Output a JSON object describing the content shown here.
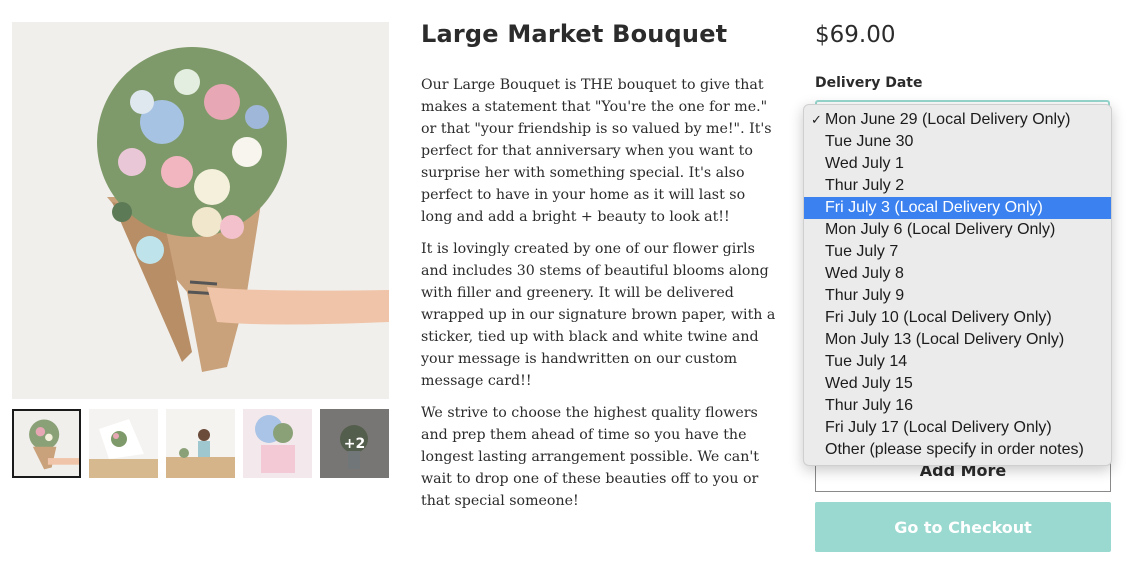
{
  "product": {
    "title": "Large Market Bouquet",
    "description": [
      "Our Large Bouquet is THE bouquet to give that makes a statement that \"You're the one for me.\" or that \"your friendship is so valued by me!\". It's perfect for that anniversary when you want to surprise her with something special. It's also perfect to have in your home as it will last so long and add a bright + beauty to look at!!",
      "It is lovingly created by one of our flower girls and includes 30 stems of beautiful blooms along with filler and greenery. It will be delivered wrapped up in our signature brown paper, with a sticker, tied up with black and white twine and your message is handwritten on our custom message card!!",
      "We strive to choose the highest quality flowers and prep them ahead of time so you have the longest lasting arrangement possible. We can't wait to drop one of these beauties off to you or that special someone!"
    ],
    "price": "$69.00"
  },
  "gallery": {
    "main_image": "bouquet-photo",
    "thumbnails": [
      {
        "image": "bouquet-in-hand",
        "active": true
      },
      {
        "image": "wrapping-bouquet"
      },
      {
        "image": "florist-at-table"
      },
      {
        "image": "pink-bouquet"
      },
      {
        "image": "vase-bouquet",
        "overlay": "+2"
      }
    ]
  },
  "delivery": {
    "label": "Delivery Date",
    "options": [
      "Mon June 29 (Local Delivery Only)",
      "Tue June 30",
      "Wed July 1",
      "Thur July 2",
      "Fri July 3 (Local Delivery Only)",
      "Mon July 6 (Local Delivery Only)",
      "Tue July 7",
      "Wed July 8",
      "Thur July 9",
      "Fri July 10 (Local Delivery Only)",
      "Mon July 13 (Local Delivery Only)",
      "Tue July 14",
      "Wed July 15",
      "Thur July 16",
      "Fri July 17 (Local Delivery Only)",
      "Other (please specify in order notes)"
    ],
    "selected_index": 0,
    "highlighted_index": 4,
    "check_glyph": "✓"
  },
  "buttons": {
    "add_more": "Add More",
    "checkout": "Go to Checkout"
  },
  "colors": {
    "accent": "#9ad9d0",
    "highlight": "#3b82f0",
    "text": "#2b2b2b"
  }
}
